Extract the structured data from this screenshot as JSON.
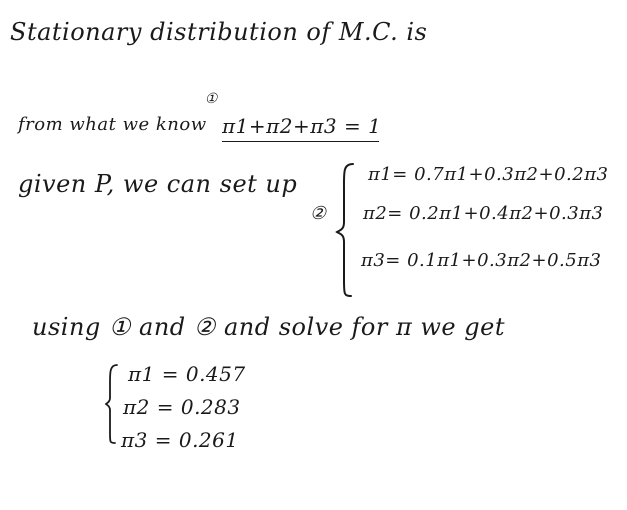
{
  "heading": "Stationary distribution of M.C. is",
  "constraint": {
    "label": "from what we know",
    "marker": "①",
    "equation": "π1+π2+π3 = 1"
  },
  "system": {
    "label": "given P, we can set up",
    "marker": "②",
    "equations": [
      "π1= 0.7π1+0.3π2+0.2π3",
      "π2= 0.2π1+0.4π2+0.3π3",
      "π3= 0.1π1+0.3π2+0.5π3"
    ]
  },
  "solve_line": "using ① and ② and solve for π we get",
  "results": [
    "π1 = 0.457",
    "π2 = 0.283",
    "π3 = 0.261"
  ]
}
